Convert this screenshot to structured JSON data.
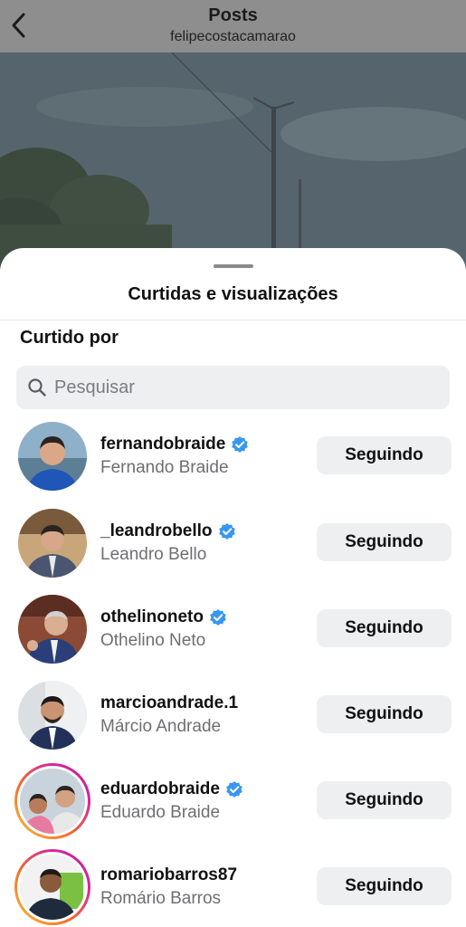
{
  "header": {
    "title": "Posts",
    "subtitle": "felipecostacamarao"
  },
  "sheet": {
    "title": "Curtidas e visualizações",
    "section_title": "Curtido por"
  },
  "search": {
    "placeholder": "Pesquisar"
  },
  "users": [
    {
      "username": "fernandobraide",
      "full_name": "Fernando Braide",
      "verified": true,
      "button_label": "Seguindo",
      "has_story_ring": false
    },
    {
      "username": "_leandrobello",
      "full_name": "Leandro Bello",
      "verified": true,
      "button_label": "Seguindo",
      "has_story_ring": false
    },
    {
      "username": "othelinoneto",
      "full_name": "Othelino Neto",
      "verified": true,
      "button_label": "Seguindo",
      "has_story_ring": false
    },
    {
      "username": "marcioandrade.1",
      "full_name": "Márcio Andrade",
      "verified": false,
      "button_label": "Seguindo",
      "has_story_ring": false
    },
    {
      "username": "eduardobraide",
      "full_name": "Eduardo Braide",
      "verified": true,
      "button_label": "Seguindo",
      "has_story_ring": true
    },
    {
      "username": "romariobarros87",
      "full_name": "Romário Barros",
      "verified": false,
      "button_label": "Seguindo",
      "has_story_ring": true
    }
  ],
  "colors": {
    "verified_badge": "#3897f0",
    "button_bg": "#eeeff1",
    "secondary_text": "#6f6f73"
  },
  "icons": {
    "back": "chevron-left-icon",
    "search": "search-icon",
    "verified": "verified-badge-icon"
  }
}
